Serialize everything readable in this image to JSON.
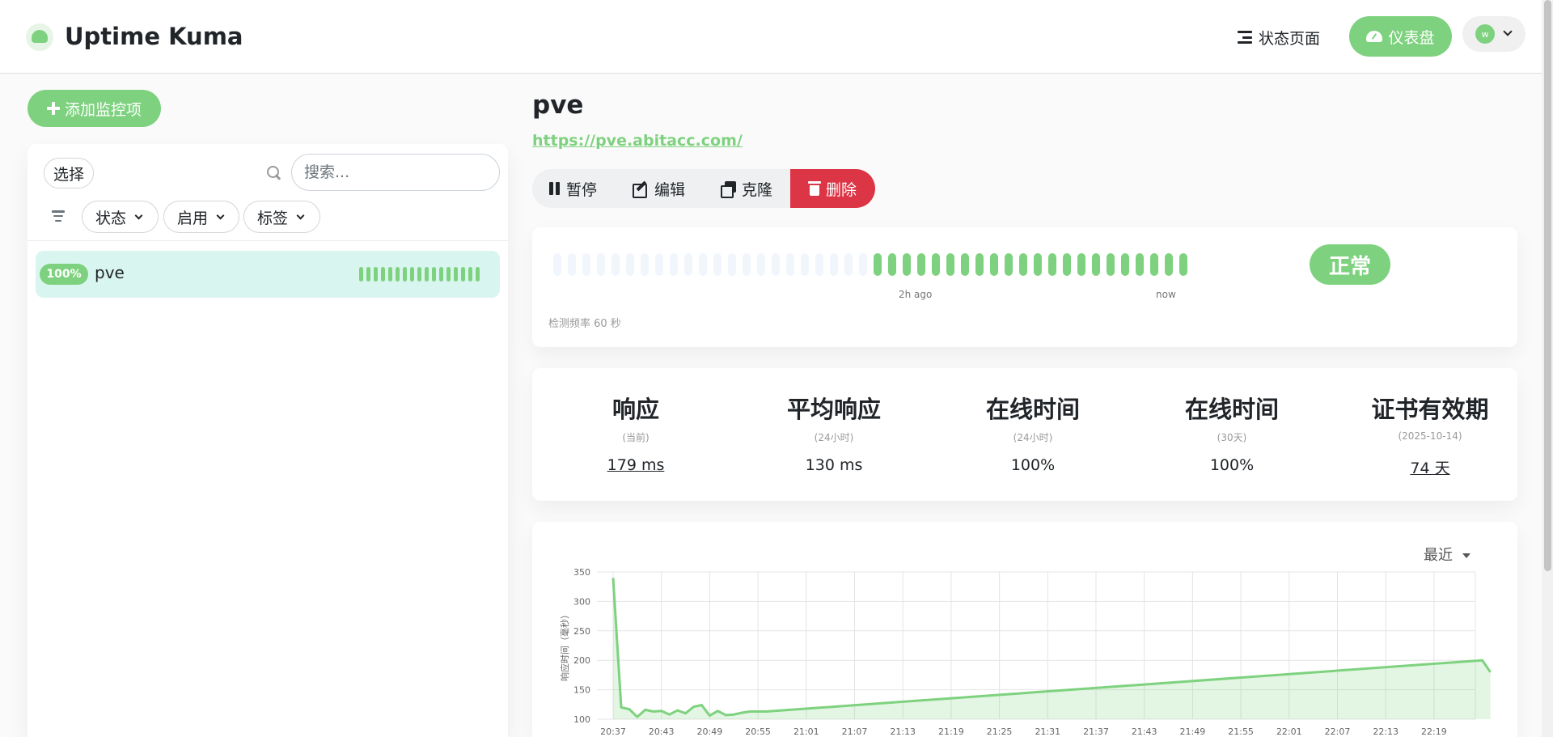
{
  "app": {
    "title": "Uptime Kuma"
  },
  "nav": {
    "status_page": "状态页面",
    "dashboard": "仪表盘",
    "avatar_letter": "w"
  },
  "sidebar": {
    "add_button": "添加监控项",
    "select_button": "选择",
    "search_placeholder": "搜索...",
    "filters": [
      "状态",
      "启用",
      "标签"
    ],
    "monitors": [
      {
        "name": "pve",
        "uptime": "100%",
        "heartbeats": 17
      }
    ]
  },
  "monitor": {
    "name": "pve",
    "url": "https://pve.abitacc.com/",
    "actions": {
      "pause": "暂停",
      "edit": "编辑",
      "clone": "克隆",
      "delete": "删除"
    },
    "heartbeat": {
      "empty_count": 22,
      "up_count": 22,
      "time_start": "2h ago",
      "time_end": "now",
      "interval": "检测频率 60 秒",
      "status": "正常"
    },
    "stats": [
      {
        "title": "响应",
        "sub": "(当前)",
        "value": "179 ms",
        "link": true
      },
      {
        "title": "平均响应",
        "sub": "(24小时)",
        "value": "130 ms",
        "link": false
      },
      {
        "title": "在线时间",
        "sub": "(24小时)",
        "value": "100%",
        "link": false
      },
      {
        "title": "在线时间",
        "sub": "(30天)",
        "value": "100%",
        "link": false
      },
      {
        "title": "证书有效期",
        "sub": "(2025-10-14)",
        "value": "74 天",
        "link": true
      }
    ]
  },
  "chart": {
    "period_label": "最近"
  },
  "colors": {
    "accent": "#7ed27f",
    "danger": "#dc3545",
    "selected_bg": "#d9f5ef"
  },
  "chart_data": {
    "type": "area",
    "title": "",
    "xlabel": "",
    "ylabel": "响应时间（毫秒）",
    "ylim": [
      100,
      350
    ],
    "yticks": [
      100,
      150,
      200,
      250,
      300,
      350
    ],
    "xticks": [
      "20:37",
      "20:43",
      "20:49",
      "20:55",
      "21:01",
      "21:07",
      "21:13",
      "21:19",
      "21:25",
      "21:31",
      "21:37",
      "21:43",
      "21:49",
      "21:55",
      "22:01",
      "22:07",
      "22:13",
      "22:19"
    ],
    "x_minutes_from_start": [
      0,
      1,
      2,
      3,
      4,
      5,
      6,
      7,
      8,
      9,
      10,
      11,
      12,
      13,
      14,
      15,
      16,
      17,
      18,
      19,
      108,
      109
    ],
    "series": [
      {
        "values": [
          340,
          120,
          117,
          104,
          116,
          113,
          114,
          108,
          115,
          110,
          121,
          124,
          106,
          114,
          107,
          108,
          111,
          113,
          113,
          113,
          200,
          180
        ]
      }
    ]
  }
}
